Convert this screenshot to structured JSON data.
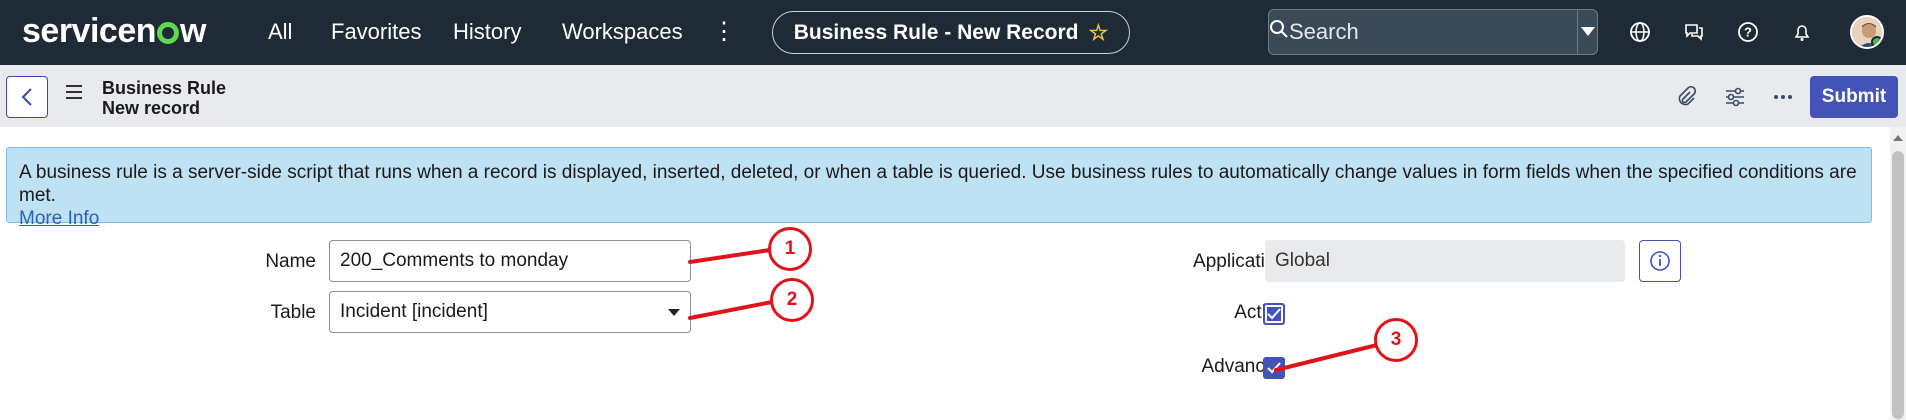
{
  "topnav": {
    "logo_text": "servicenow",
    "links": [
      "All",
      "Favorites",
      "History",
      "Workspaces"
    ],
    "record_title": "Business Rule - New Record",
    "search_placeholder": "Search"
  },
  "subheader": {
    "record_type": "Business Rule",
    "record_state": "New record",
    "submit_label": "Submit"
  },
  "info_banner": {
    "text": "A business rule is a server-side script that runs when a record is displayed, inserted, deleted, or when a table is queried. Use business rules to automatically change values in form fields when the specified conditions are met.",
    "link_text": "More Info"
  },
  "form": {
    "name_label": "Name",
    "name_value": "200_Comments to monday",
    "table_label": "Table",
    "table_value": "Incident [incident]",
    "application_label": "Application",
    "application_value": "Global",
    "active_label": "Active",
    "active_checked": true,
    "advanced_label": "Advanced",
    "advanced_checked": true
  },
  "annotations": [
    "1",
    "2",
    "3"
  ],
  "colors": {
    "nav_bg": "#1e2b36",
    "accent": "#4353b8",
    "banner_bg": "#bfe1f4",
    "annotation_red": "#e0131a",
    "logo_green": "#62d84e"
  },
  "icons": [
    "search-icon",
    "chevron-down-icon",
    "globe-icon",
    "chat-icon",
    "help-icon",
    "bell-icon",
    "back-icon",
    "menu-icon",
    "paperclip-icon",
    "sliders-icon",
    "more-icon",
    "info-icon",
    "star-icon"
  ]
}
